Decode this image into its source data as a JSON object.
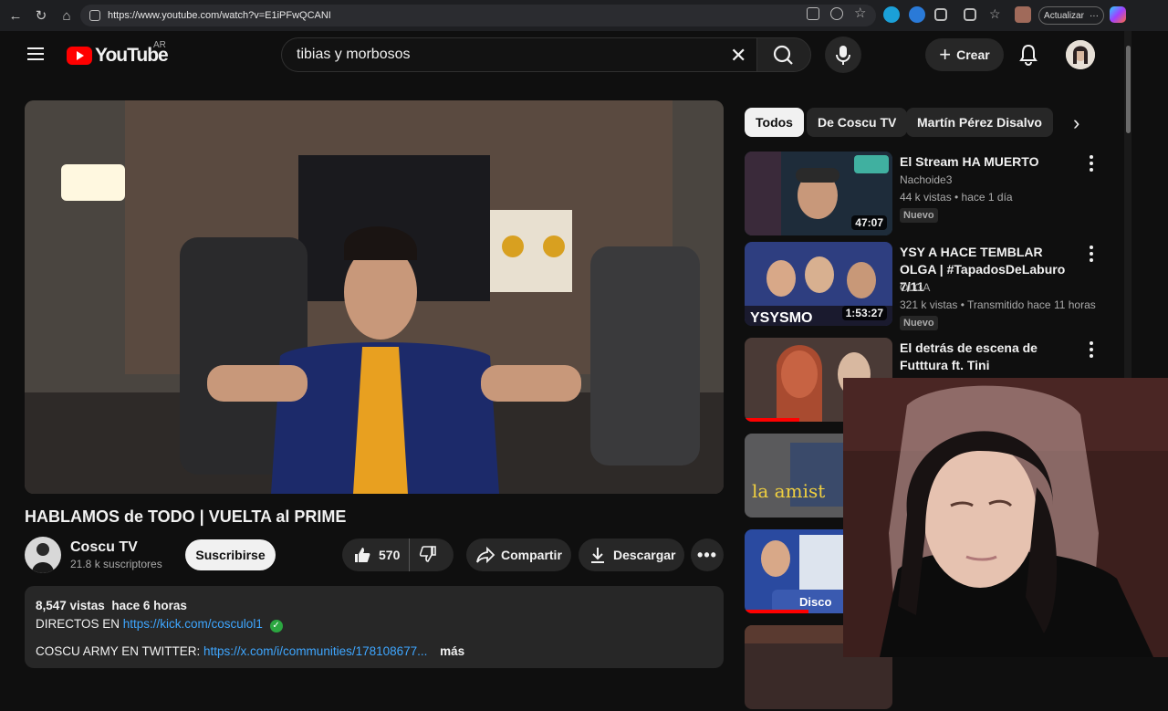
{
  "browser": {
    "url": "https://www.youtube.com/watch?v=E1iPFwQCANI",
    "update_label": "Actualizar"
  },
  "header": {
    "logo": "YouTube",
    "country": "AR",
    "search_value": "tibias y morbosos",
    "create_label": "Crear"
  },
  "video": {
    "title": "HABLAMOS de TODO | VUELTA al PRIME",
    "channel": "Coscu TV",
    "subscribers": "21.8 k suscriptores",
    "subscribe_label": "Suscribirse",
    "likes": "570",
    "share_label": "Compartir",
    "download_label": "Descargar"
  },
  "description": {
    "views": "8,547 vistas",
    "time": "hace 6 horas",
    "line2_prefix": "DIRECTOS EN ",
    "line2_link": "https://kick.com/cosculol1",
    "line3_prefix": "COSCU ARMY EN TWITTER: ",
    "line3_link": "https://x.com/i/communities/178108677...",
    "more": "más"
  },
  "chips": [
    "Todos",
    "De Coscu TV",
    "Martín Pérez Disalvo"
  ],
  "recommendations": [
    {
      "title": "El Stream HA MUERTO",
      "channel": "Nachoide3",
      "meta": "44 k vistas • hace 1 día",
      "badge": "Nuevo",
      "duration": "47:07",
      "color": "#2a3a4a"
    },
    {
      "title": "YSY A HACE TEMBLAR OLGA | #TapadosDeLaburo 7/11",
      "channel": "OLGA",
      "meta": "321 k vistas • Transmitido hace 11 horas",
      "badge": "Nuevo",
      "duration": "1:53:27",
      "color": "#3a4f8a"
    },
    {
      "title": "El detrás de escena de Futttura ft. Tini",
      "channel": "",
      "meta": "",
      "badge": "",
      "duration": "",
      "color": "#6a4a3a"
    },
    {
      "title": "",
      "channel": "",
      "meta": "",
      "badge": "",
      "duration": "",
      "color": "#5a5a5a"
    },
    {
      "title": "",
      "channel": "",
      "meta": "",
      "badge": "",
      "duration": "",
      "color": "#2a4a8a"
    },
    {
      "title": "",
      "channel": "",
      "meta": "",
      "badge": "",
      "duration": "",
      "color": "#3a2a2a"
    }
  ],
  "colors": {
    "accent": "#ff0000",
    "link": "#3ea6ff",
    "bg": "#0f0f0f"
  }
}
